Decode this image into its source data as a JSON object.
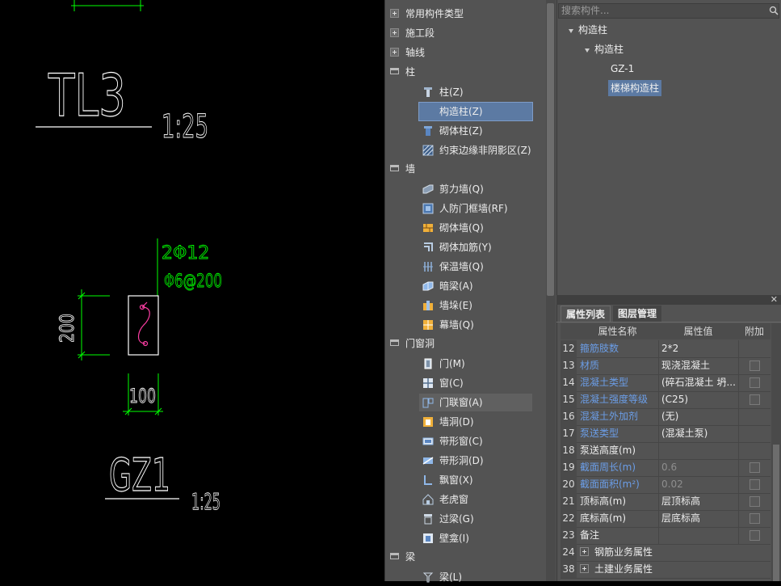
{
  "cad": {
    "label_tl3": "TL3",
    "scale_1": "1:25",
    "rebar_top": "2Φ12",
    "rebar_stirrup": "Φ6@200",
    "dim_vertical": "200",
    "dim_horizontal": "100",
    "label_gz1": "GZ1",
    "scale_2": "1:25",
    "colors": {
      "background": "#000000",
      "line": "#ffffff",
      "dimension": "#00ff00",
      "rebar": "#ff3ea5"
    }
  },
  "tree": {
    "categories": [
      {
        "label": "常用构件类型",
        "state": "collapsed"
      },
      {
        "label": "施工段",
        "state": "collapsed"
      },
      {
        "label": "轴线",
        "state": "collapsed"
      },
      {
        "label": "柱",
        "state": "expanded"
      },
      {
        "label": "墙",
        "state": "expanded"
      },
      {
        "label": "门窗洞",
        "state": "expanded"
      },
      {
        "label": "梁",
        "state": "expanded"
      }
    ],
    "items": [
      {
        "label": "柱(Z)",
        "icon": "column-icon"
      },
      {
        "label": "构造柱(Z)",
        "icon": "structural-column-icon",
        "selected": true
      },
      {
        "label": "砌体柱(Z)",
        "icon": "masonry-column-icon"
      },
      {
        "label": "约束边缘非阴影区(Z)",
        "icon": "constraint-edge-icon"
      },
      {
        "label": "剪力墙(Q)",
        "icon": "shear-wall-icon"
      },
      {
        "label": "人防门框墙(RF)",
        "icon": "civil-defense-door-wall-icon"
      },
      {
        "label": "砌体墙(Q)",
        "icon": "masonry-wall-icon"
      },
      {
        "label": "砌体加筋(Y)",
        "icon": "masonry-rebar-icon"
      },
      {
        "label": "保温墙(Q)",
        "icon": "insulation-wall-icon"
      },
      {
        "label": "暗梁(A)",
        "icon": "hidden-beam-icon"
      },
      {
        "label": "墙垛(E)",
        "icon": "wall-pier-icon"
      },
      {
        "label": "幕墙(Q)",
        "icon": "curtain-wall-icon"
      },
      {
        "label": "门(M)",
        "icon": "door-icon"
      },
      {
        "label": "窗(C)",
        "icon": "window-icon"
      },
      {
        "label": "门联窗(A)",
        "icon": "door-window-icon",
        "hovered": true
      },
      {
        "label": "墙洞(D)",
        "icon": "wall-opening-icon"
      },
      {
        "label": "带形窗(C)",
        "icon": "strip-window-icon"
      },
      {
        "label": "带形洞(D)",
        "icon": "strip-opening-icon"
      },
      {
        "label": "飘窗(X)",
        "icon": "bay-window-icon"
      },
      {
        "label": "老虎窗",
        "icon": "dormer-window-icon"
      },
      {
        "label": "过梁(G)",
        "icon": "lintel-icon"
      },
      {
        "label": "壁龛(I)",
        "icon": "niche-icon"
      },
      {
        "label": "梁(L)",
        "icon": "beam-icon"
      }
    ]
  },
  "instances": {
    "search_placeholder": "搜索构件...",
    "root": "构造柱",
    "group": "构造柱",
    "children": [
      "GZ-1",
      "楼梯构造柱"
    ],
    "selected": "楼梯构造柱"
  },
  "properties": {
    "tabs": [
      "属性列表",
      "图层管理"
    ],
    "headers": [
      "属性名称",
      "属性值",
      "附加"
    ],
    "rows": [
      {
        "num": "12",
        "name": "箍筋肢数",
        "value": "2*2",
        "blue": true,
        "checkbox": false
      },
      {
        "num": "13",
        "name": "材质",
        "value": "现浇混凝土",
        "blue": true,
        "checkbox": true
      },
      {
        "num": "14",
        "name": "混凝土类型",
        "value": "(碎石混凝土 坍...",
        "blue": true,
        "checkbox": true
      },
      {
        "num": "15",
        "name": "混凝土强度等级",
        "value": "(C25)",
        "blue": true,
        "checkbox": true
      },
      {
        "num": "16",
        "name": "混凝土外加剂",
        "value": "(无)",
        "blue": true,
        "checkbox": false
      },
      {
        "num": "17",
        "name": "泵送类型",
        "value": "(混凝土泵)",
        "blue": true,
        "checkbox": false
      },
      {
        "num": "18",
        "name": "泵送高度(m)",
        "value": "",
        "blue": false,
        "checkbox": false
      },
      {
        "num": "19",
        "name": "截面周长(m)",
        "value": "0.6",
        "blue": true,
        "checkbox": true,
        "dim": true
      },
      {
        "num": "20",
        "name": "截面面积(m²)",
        "value": "0.02",
        "blue": true,
        "checkbox": true,
        "dim": true
      },
      {
        "num": "21",
        "name": "顶标高(m)",
        "value": "层顶标高",
        "blue": false,
        "checkbox": true
      },
      {
        "num": "22",
        "name": "底标高(m)",
        "value": "层底标高",
        "blue": false,
        "checkbox": true
      },
      {
        "num": "23",
        "name": "备注",
        "value": "",
        "blue": false,
        "checkbox": true
      },
      {
        "num": "24",
        "name": "钢筋业务属性",
        "value": "",
        "blue": false,
        "checkbox": false,
        "expand": true
      },
      {
        "num": "38",
        "name": "土建业务属性",
        "value": "",
        "blue": false,
        "checkbox": false,
        "expand": true
      }
    ]
  }
}
